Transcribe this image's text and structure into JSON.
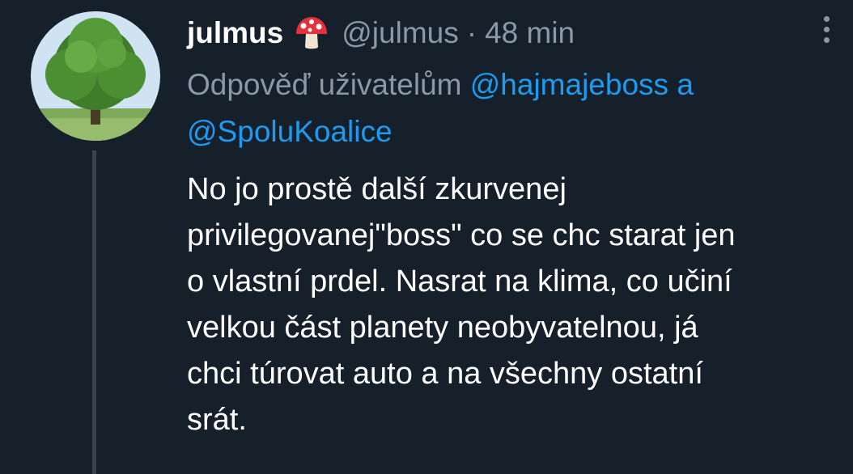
{
  "tweet": {
    "author": {
      "name": "julmus",
      "badge_emoji": "mushroom-icon",
      "handle": "@julmus",
      "separator": "·",
      "time": "48 min",
      "avatar": "tree-avatar"
    },
    "reply_to": {
      "prefix": "Odpověď uživatelům",
      "mentions": [
        "@hajmajeboss",
        "@SpoluKoalice"
      ],
      "conjunction": "a"
    },
    "text_lines": [
      "No jo prostě další zkurvenej",
      "privilegovanej\"boss\" co se chc starat jen",
      "o vlastní prdel. Nasrat na klima, co učiní",
      "velkou část planety neobyvatelnou, já",
      "chci túrovat auto a na všechny ostatní",
      "srát."
    ]
  },
  "colors": {
    "background": "#15202b",
    "text": "#ffffff",
    "secondary": "#8b98a5",
    "link": "#1d9bf0",
    "thread_line": "#38444d"
  },
  "icons": {
    "more": "more-vertical-icon",
    "badge": "mushroom-icon"
  }
}
